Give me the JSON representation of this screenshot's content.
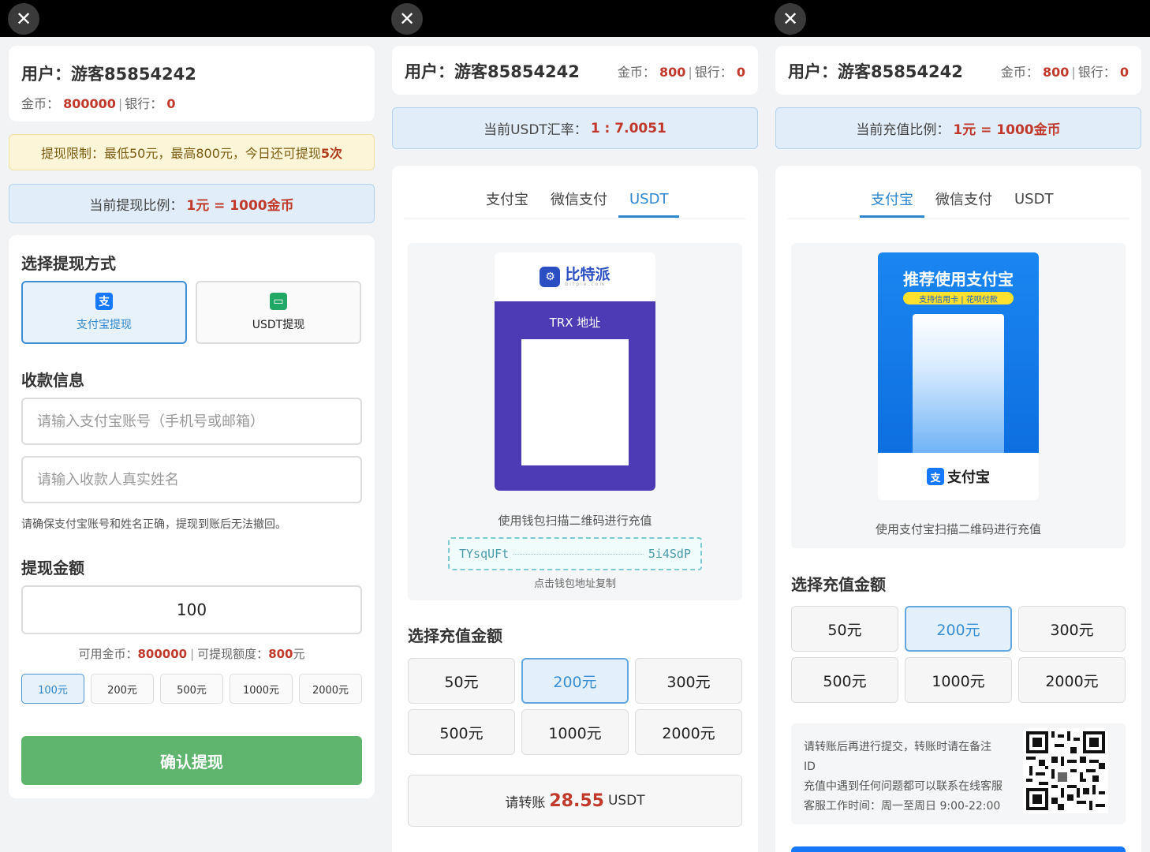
{
  "user": {
    "label": "用户：",
    "name": "游客85854242"
  },
  "coin_label": "金币：",
  "bank_label": "银行：",
  "sep": "|",
  "panel1": {
    "gold": "800000",
    "bank": "0",
    "limit_prefix": "提现限制：最低50元，最高800元，今日还可提现",
    "limit_count": "5次",
    "ratio_prefix": "当前提现比例：",
    "ratio_value": "1元 = 1000金币",
    "method_title": "选择提现方式",
    "methods": [
      {
        "label": "支付宝提现",
        "icon": "alipay-icon"
      },
      {
        "label": "USDT提现",
        "icon": "wallet-icon"
      }
    ],
    "info_title": "收款信息",
    "account_placeholder": "请输入支付宝账号（手机号或邮箱）",
    "name_placeholder": "请输入收款人真实姓名",
    "notice": "请确保支付宝账号和姓名正确，提现到账后无法撤回。",
    "amount_title": "提现金额",
    "amount_value": "100",
    "avail_label": "可用金币：",
    "avail_value": "800000",
    "quota_label": "可提现额度：",
    "quota_value": "800",
    "quota_unit": "元",
    "chips": [
      "100元",
      "200元",
      "500元",
      "1000元",
      "2000元"
    ],
    "confirm": "确认提现"
  },
  "panel2": {
    "gold": "800",
    "bank": "0",
    "rate_prefix": "当前USDT汇率：",
    "rate_value": "1 : 7.0051",
    "tabs": [
      "支付宝",
      "微信支付",
      "USDT"
    ],
    "brand": "比特派",
    "brand_sub": "bitpie.com",
    "trx": "TRX 地址",
    "scan_hint": "使用钱包扫描二维码进行充值",
    "address_start": "TYsqUFt",
    "address_end": "5i4SdP",
    "copy_hint": "点击钱包地址复制",
    "amount_title": "选择充值金额",
    "amounts": [
      "50元",
      "200元",
      "300元",
      "500元",
      "1000元",
      "2000元"
    ],
    "transfer_prefix": "请转账",
    "transfer_value": "28.55",
    "transfer_unit": "USDT"
  },
  "panel3": {
    "gold": "800",
    "bank": "0",
    "ratio_prefix": "当前充值比例：",
    "ratio_value": "1元 = 1000金币",
    "tabs": [
      "支付宝",
      "微信支付",
      "USDT"
    ],
    "promo_title": "推荐使用支付宝",
    "promo_sub": "支持信用卡 | 花呗付款",
    "alipay_brand": "支付宝",
    "scan_hint": "使用支付宝扫描二维码进行充值",
    "amount_title": "选择充值金额",
    "amounts": [
      "50元",
      "200元",
      "300元",
      "500元",
      "1000元",
      "2000元"
    ],
    "notice_lines": [
      "请转账后再进行提交，转账时请在备注",
      "ID",
      "充值中遇到任何问题都可以联系在线客服",
      "客服工作时间：周一至周日 9:00-22:00"
    ]
  },
  "colors": {
    "accent": "#2f86cc",
    "red": "#c0392b",
    "green": "#5fb46e",
    "bitpie_purple": "#4c3bb5",
    "alipay_blue": "#1677ff"
  }
}
